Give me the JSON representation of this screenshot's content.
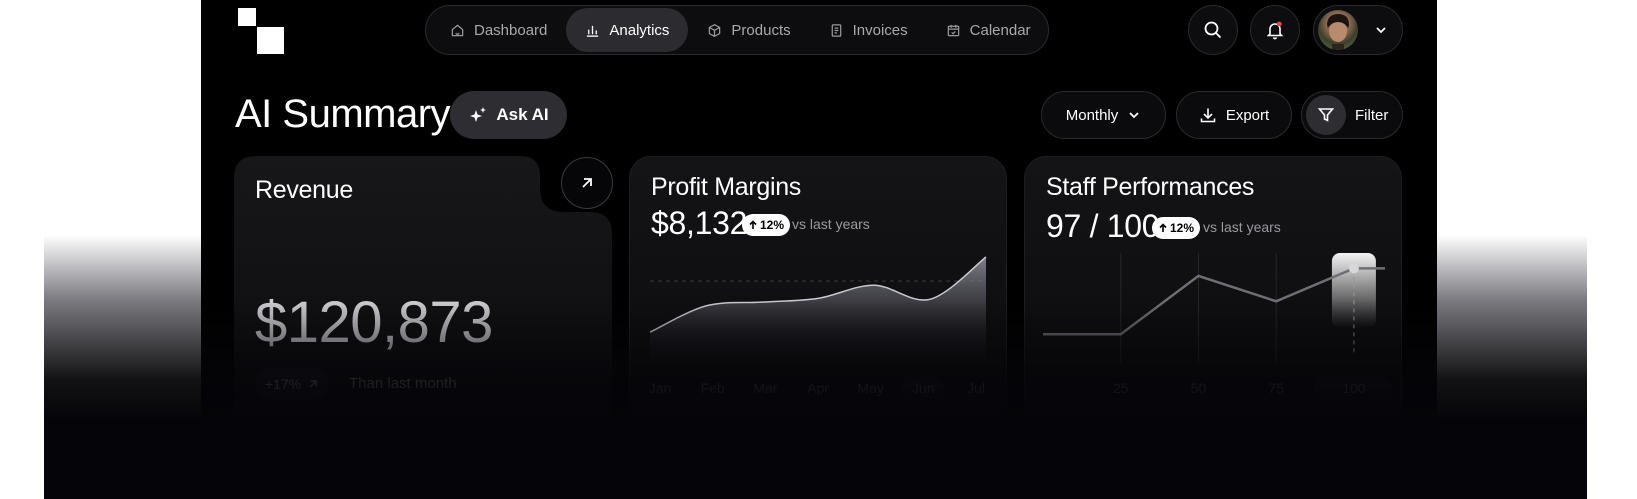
{
  "nav": {
    "items": [
      {
        "label": "Dashboard",
        "icon": "home-icon"
      },
      {
        "label": "Analytics",
        "icon": "bar-chart-icon"
      },
      {
        "label": "Products",
        "icon": "box-icon"
      },
      {
        "label": "Invoices",
        "icon": "receipt-icon"
      },
      {
        "label": "Calendar",
        "icon": "calendar-icon"
      }
    ],
    "active": "Analytics"
  },
  "header": {
    "search_icon": "search-icon",
    "notification_icon": "bell-icon",
    "notification_dot_color": "#e5484d"
  },
  "page": {
    "title": "AI Summary",
    "ask_ai_label": "Ask AI",
    "period_label": "Monthly",
    "export_label": "Export",
    "filter_label": "Filter"
  },
  "revenue": {
    "title": "Revenue",
    "value": "$120,873",
    "change": "+17%",
    "change_caption": "Than last month"
  },
  "profit": {
    "title": "Profit Margins",
    "value": "$8,132",
    "badge": "12%",
    "caption": "vs last years",
    "months": [
      "Jan",
      "Feb",
      "Mar",
      "Apr",
      "May",
      "Jun",
      "Jul"
    ],
    "selected": "Jun"
  },
  "staff": {
    "title": "Staff Performances",
    "value": "97 / 100",
    "badge": "12%",
    "caption": "vs last years",
    "ticks": [
      "25",
      "50",
      "75",
      "100"
    ],
    "selected": "100"
  },
  "chart_data": [
    {
      "type": "area",
      "title": "Profit Margins",
      "x": [
        "Jan",
        "Feb",
        "Mar",
        "Apr",
        "May",
        "Jun",
        "Jul"
      ],
      "values": [
        20,
        48,
        52,
        56,
        70,
        55,
        100
      ],
      "ylim": [
        0,
        100
      ]
    },
    {
      "type": "line",
      "title": "Staff Performances",
      "x": [
        0,
        25,
        50,
        75,
        100,
        110
      ],
      "values": [
        20,
        20,
        82,
        55,
        90,
        90
      ],
      "ylim": [
        0,
        100
      ]
    }
  ]
}
